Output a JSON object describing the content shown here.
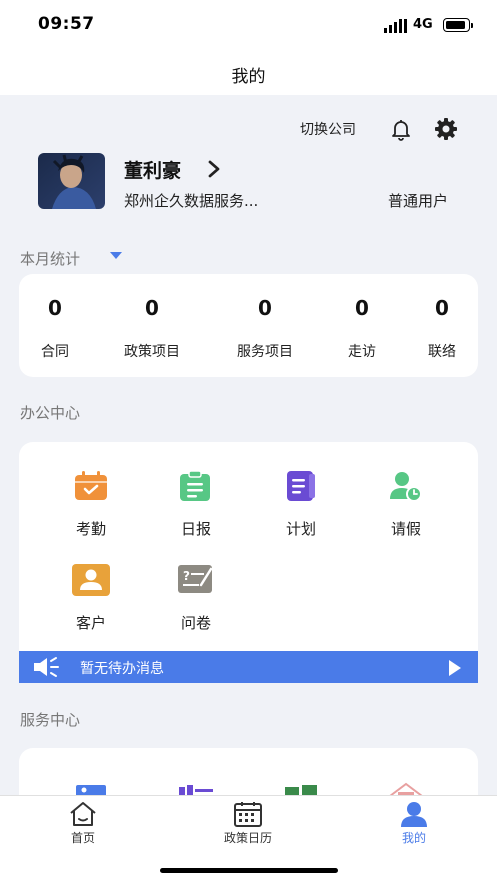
{
  "status_bar": {
    "time": "09:57",
    "network": "4G"
  },
  "nav": {
    "title": "我的"
  },
  "header": {
    "switch_company": "切换公司",
    "icons": [
      "bell-icon",
      "gear-icon"
    ]
  },
  "profile": {
    "name": "董利豪",
    "company": "郑州企久数据服务...",
    "role": "普通用户"
  },
  "monthly_stats": {
    "title": "本月统计",
    "items": [
      {
        "value": "0",
        "label": "合同"
      },
      {
        "value": "0",
        "label": "政策项目"
      },
      {
        "value": "0",
        "label": "服务项目"
      },
      {
        "value": "0",
        "label": "走访"
      },
      {
        "value": "0",
        "label": "联络"
      }
    ]
  },
  "office_center": {
    "title": "办公中心",
    "items": [
      {
        "label": "考勤",
        "icon": "attendance-icon",
        "color": "#f0913a"
      },
      {
        "label": "日报",
        "icon": "daily-report-icon",
        "color": "#57c785"
      },
      {
        "label": "计划",
        "icon": "plan-icon",
        "color": "#6a4bd3"
      },
      {
        "label": "请假",
        "icon": "leave-icon",
        "color": "#57c785"
      },
      {
        "label": "客户",
        "icon": "customer-icon",
        "color": "#e8a23a"
      },
      {
        "label": "问卷",
        "icon": "questionnaire-icon",
        "color": "#8d8a82"
      }
    ],
    "todo_message": "暂无待办消息"
  },
  "service_center": {
    "title": "服务中心"
  },
  "tab_bar": {
    "items": [
      {
        "label": "首页",
        "icon": "home-icon",
        "active": false
      },
      {
        "label": "政策日历",
        "icon": "calendar-icon",
        "active": false
      },
      {
        "label": "我的",
        "icon": "profile-icon",
        "active": true
      }
    ]
  },
  "colors": {
    "accent": "#4a7be8",
    "background": "#f0f2f7",
    "card": "#ffffff"
  }
}
